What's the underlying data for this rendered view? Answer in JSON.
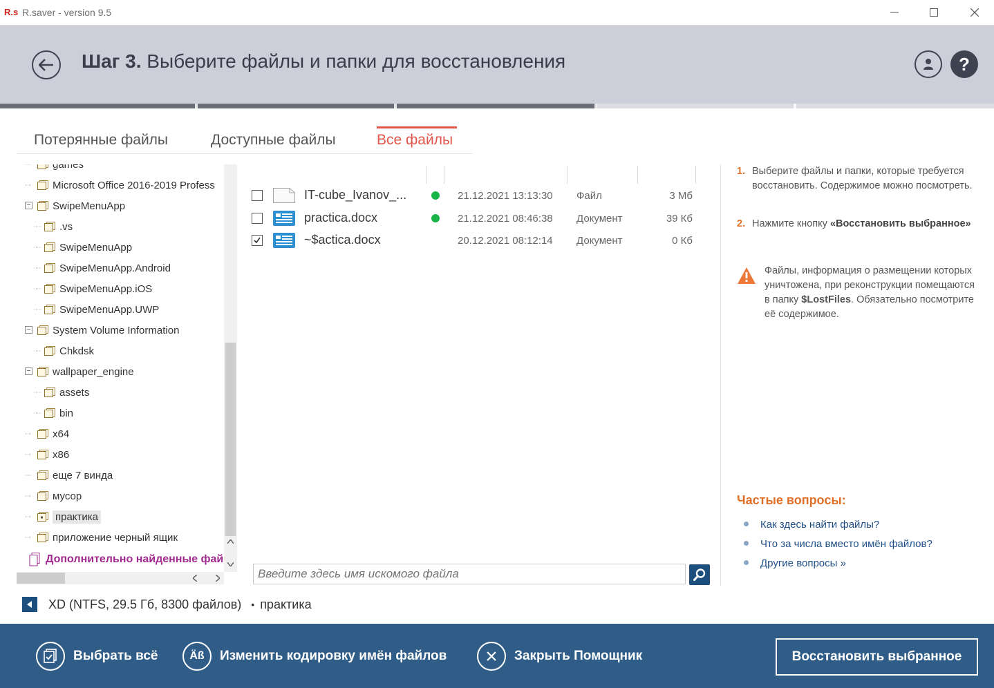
{
  "window": {
    "logo": "R.s",
    "title": "R.saver - version 9.5"
  },
  "header": {
    "step_bold": "Шаг 3.",
    "step_text": "Выберите файлы и папки для восстановления",
    "progress_fraction": 0.6
  },
  "tabs": [
    {
      "label": "Потерянные файлы",
      "active": false
    },
    {
      "label": "Доступные файлы",
      "active": false
    },
    {
      "label": "Все файлы",
      "active": true
    }
  ],
  "tree": {
    "items": [
      {
        "label": "games",
        "level": 1,
        "expander": ""
      },
      {
        "label": "Microsoft Office 2016-2019 Profess",
        "level": 1,
        "expander": ""
      },
      {
        "label": "SwipeMenuApp",
        "level": 1,
        "expander": "⊟"
      },
      {
        "label": ".vs",
        "level": 2,
        "expander": ""
      },
      {
        "label": "SwipeMenuApp",
        "level": 2,
        "expander": ""
      },
      {
        "label": "SwipeMenuApp.Android",
        "level": 2,
        "expander": ""
      },
      {
        "label": "SwipeMenuApp.iOS",
        "level": 2,
        "expander": ""
      },
      {
        "label": "SwipeMenuApp.UWP",
        "level": 2,
        "expander": ""
      },
      {
        "label": "System Volume Information",
        "level": 1,
        "expander": "⊟"
      },
      {
        "label": "Chkdsk",
        "level": 2,
        "expander": ""
      },
      {
        "label": "wallpaper_engine",
        "level": 1,
        "expander": "⊟"
      },
      {
        "label": "assets",
        "level": 2,
        "expander": ""
      },
      {
        "label": "bin",
        "level": 2,
        "expander": ""
      },
      {
        "label": "x64",
        "level": 1,
        "expander": ""
      },
      {
        "label": "x86",
        "level": 1,
        "expander": ""
      },
      {
        "label": "еще 7 винда",
        "level": 1,
        "expander": ""
      },
      {
        "label": "мусор",
        "level": 1,
        "expander": ""
      },
      {
        "label": "практика",
        "level": 1,
        "expander": "",
        "selected": true
      },
      {
        "label": "приложение черный ящик",
        "level": 1,
        "expander": ""
      }
    ],
    "special": "Дополнительно найденные фай"
  },
  "files": [
    {
      "name": "IT-cube_Ivanov_...",
      "status": "green",
      "date": "21.12.2021 13:13:30",
      "type": "Файл",
      "size": "3 Мб",
      "checked": false,
      "icon": "blank-file-icon"
    },
    {
      "name": "practica.docx",
      "status": "green",
      "date": "21.12.2021 08:46:38",
      "type": "Документ",
      "size": "39 Кб",
      "checked": false,
      "icon": "document-icon"
    },
    {
      "name": "~$actica.docx",
      "status": "",
      "date": "20.12.2021 08:12:14",
      "type": "Документ",
      "size": "0 Кб",
      "checked": true,
      "icon": "document-icon"
    }
  ],
  "search": {
    "placeholder": "Введите здесь имя искомого файла"
  },
  "info": {
    "step1_num": "1.",
    "step1_text": "Выберите файлы и папки, которые требуется восстановить. Содержимое можно посмотреть.",
    "step2_num": "2.",
    "step2_pre": "Нажмите кнопку ",
    "step2_bold": "«Восстановить выбранное»",
    "warn_pre": "Файлы, информация о размещении которых уничтожена, при реконструкции помещаются в папку ",
    "warn_bold": "$LostFiles",
    "warn_post": ". Обязательно посмотрите её содержимое.",
    "faq_title": "Частые вопросы:",
    "faq": [
      "Как здесь найти файлы?",
      "Что за числа вместо имён файлов?",
      "Другие вопросы »"
    ]
  },
  "status": {
    "disk": "XD (NTFS, 29.5 Гб, 8300 файлов)",
    "separator": "•",
    "folder": "практика"
  },
  "footer": {
    "select_all": "Выбрать всё",
    "encoding": "Изменить кодировку имён файлов",
    "encoding_icon_text": "Äß",
    "close_helper": "Закрыть Помощник",
    "restore": "Восстановить выбранное"
  },
  "colors": {
    "accent_orange": "#e07028",
    "tab_active": "#e2554a",
    "footer_bg": "#2f5d88",
    "header_bg": "#ccced9",
    "status_green": "#19b548"
  }
}
